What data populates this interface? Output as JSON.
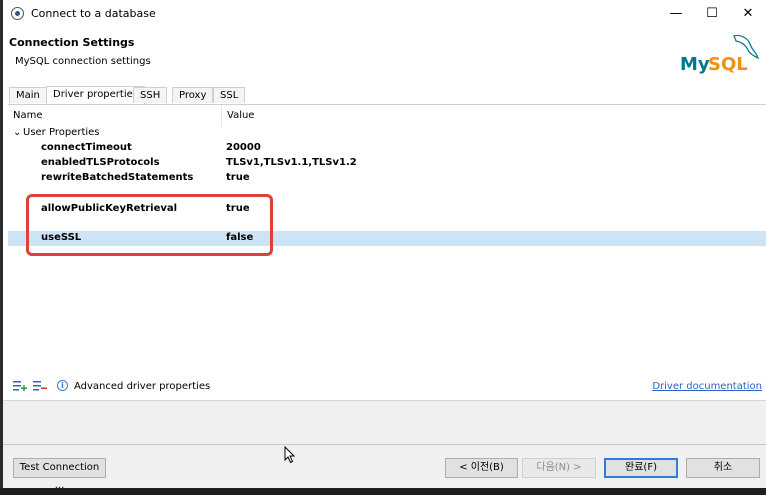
{
  "window": {
    "title": "Connect to a database",
    "controls": {
      "minimize": "—",
      "maximize": "☐",
      "close": "✕"
    }
  },
  "header": {
    "title": "Connection Settings",
    "subtitle": "MySQL connection settings",
    "logo_text": "MySQL"
  },
  "tabs": [
    {
      "label": "Main"
    },
    {
      "label": "Driver properties",
      "active": true
    },
    {
      "label": "SSH"
    },
    {
      "label": "Proxy"
    },
    {
      "label": "SSL"
    }
  ],
  "table": {
    "col_name": "Name",
    "col_value": "Value",
    "group_label": "User Properties",
    "rows": [
      {
        "name": "connectTimeout",
        "value": "20000"
      },
      {
        "name": "enabledTLSProtocols",
        "value": "TLSv1,TLSv1.1,TLSv1.2"
      },
      {
        "name": "rewriteBatchedStatements",
        "value": "true"
      },
      {
        "name": "allowPublicKeyRetrieval",
        "value": "true"
      },
      {
        "name": "useSSL",
        "value": "false",
        "selected": true
      }
    ]
  },
  "toolbar": {
    "advanced_label": "Advanced driver properties",
    "doc_link": "Driver documentation"
  },
  "footer": {
    "test_connection": "Test Connection ...",
    "back": "< 이전(B)",
    "next": "다음(N) >",
    "finish": "완료(F)",
    "cancel": "취소"
  },
  "colors": {
    "selection": "#cde4f7",
    "highlight_box": "#e0403a",
    "link": "#2a64c8",
    "mysql_blue": "#00758f",
    "mysql_orange": "#f29111"
  }
}
